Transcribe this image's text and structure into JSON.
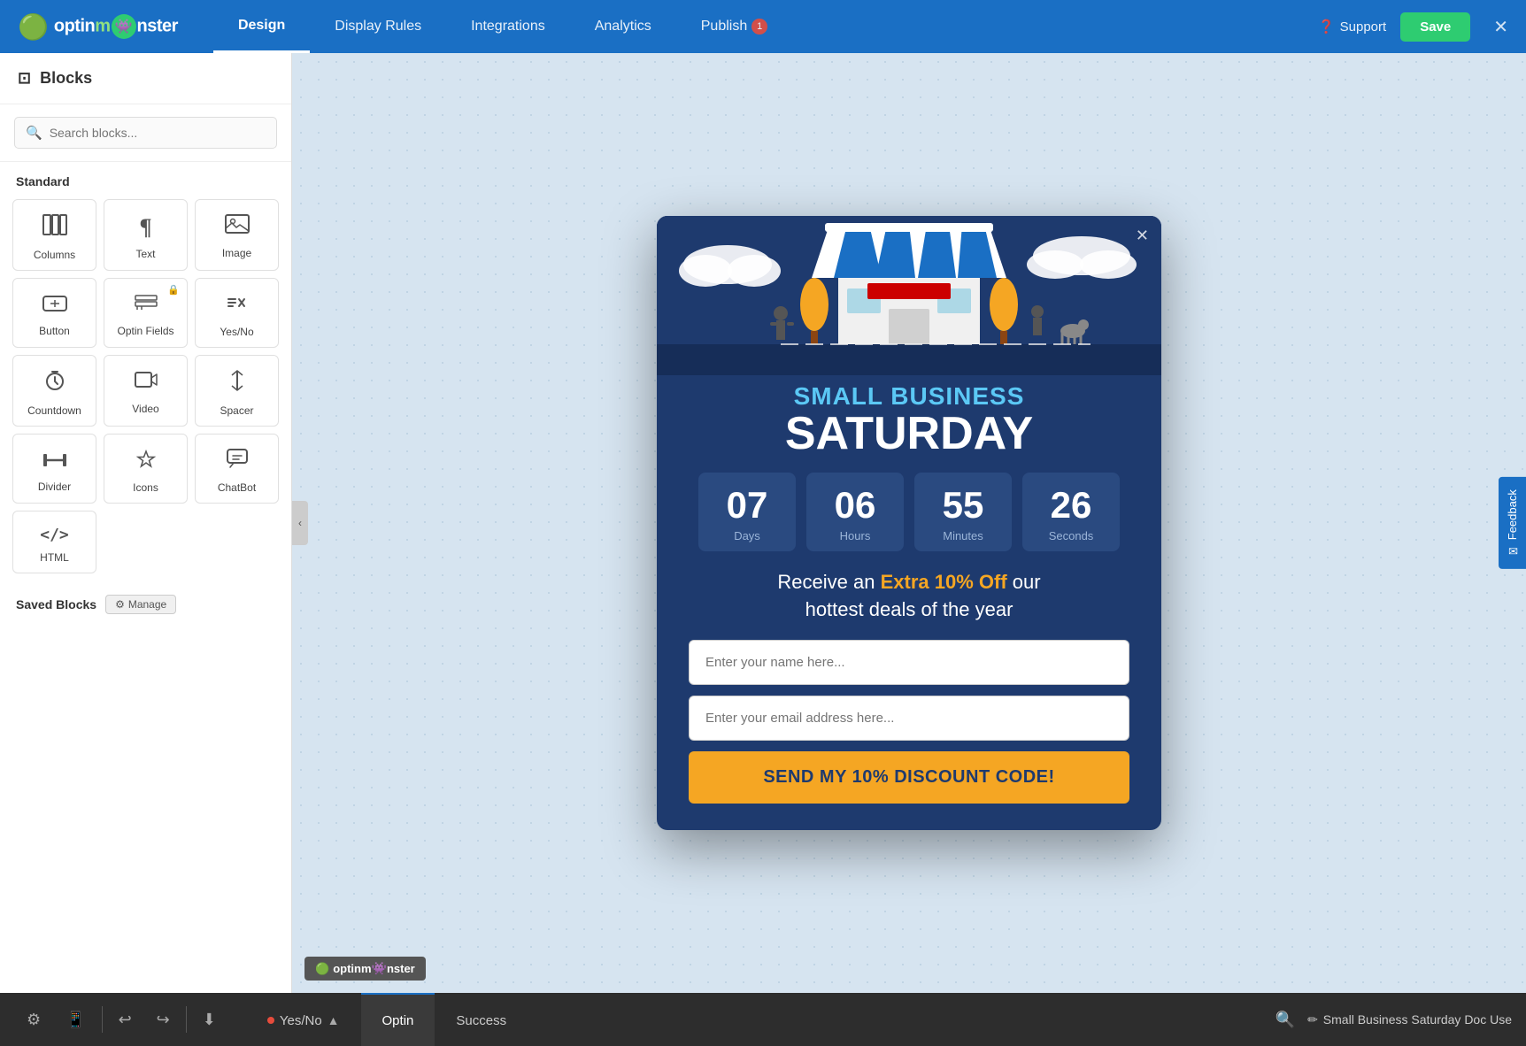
{
  "nav": {
    "logo_text": "optinm nster",
    "links": [
      {
        "label": "Design",
        "active": true
      },
      {
        "label": "Display Rules",
        "active": false
      },
      {
        "label": "Integrations",
        "active": false
      },
      {
        "label": "Analytics",
        "active": false
      },
      {
        "label": "Publish",
        "active": false,
        "badge": "1"
      }
    ],
    "support_label": "Support",
    "save_label": "Save"
  },
  "sidebar": {
    "title": "Blocks",
    "search_placeholder": "Search blocks...",
    "section_standard": "Standard",
    "blocks": [
      {
        "id": "columns",
        "label": "Columns",
        "icon": "⊞",
        "locked": false
      },
      {
        "id": "text",
        "label": "Text",
        "icon": "¶",
        "locked": false
      },
      {
        "id": "image",
        "label": "Image",
        "icon": "🖼",
        "locked": false
      },
      {
        "id": "button",
        "label": "Button",
        "icon": "⊡",
        "locked": false
      },
      {
        "id": "optin-fields",
        "label": "Optin Fields",
        "icon": "≡",
        "locked": true
      },
      {
        "id": "yes-no",
        "label": "Yes/No",
        "icon": "⇄",
        "locked": false
      },
      {
        "id": "countdown",
        "label": "Countdown",
        "icon": "⏰",
        "locked": false
      },
      {
        "id": "video",
        "label": "Video",
        "icon": "▶",
        "locked": false
      },
      {
        "id": "spacer",
        "label": "Spacer",
        "icon": "↕",
        "locked": false
      },
      {
        "id": "divider",
        "label": "Divider",
        "icon": "⊣",
        "locked": false
      },
      {
        "id": "icons",
        "label": "Icons",
        "icon": "❤",
        "locked": false
      },
      {
        "id": "chatbot",
        "label": "ChatBot",
        "icon": "💬",
        "locked": false
      },
      {
        "id": "html",
        "label": "HTML",
        "icon": "</>",
        "locked": false
      }
    ],
    "saved_blocks_label": "Saved Blocks",
    "manage_label": "Manage"
  },
  "popup": {
    "close_icon": "✕",
    "title_line1": "SMALL BUSINESS",
    "title_line2": "SATURDAY",
    "countdown": {
      "days": {
        "value": "07",
        "label": "Days"
      },
      "hours": {
        "value": "06",
        "label": "Hours"
      },
      "minutes": {
        "value": "55",
        "label": "Minutes"
      },
      "seconds": {
        "value": "26",
        "label": "Seconds"
      }
    },
    "offer_text_before": "Receive an ",
    "offer_highlight": "Extra 10% Off",
    "offer_text_after": " our\nhottest deals of the year",
    "name_placeholder": "Enter your name here...",
    "email_placeholder": "Enter your email address here...",
    "cta_label": "Send My 10% Discount Code!"
  },
  "watermark": {
    "label": "optinm nster"
  },
  "feedback": {
    "label": "Feedback"
  },
  "bottom_bar": {
    "tabs": [
      {
        "label": "Yes/No",
        "active": false,
        "has_dot": true
      },
      {
        "label": "Optin",
        "active": true,
        "has_dot": false
      },
      {
        "label": "Success",
        "active": false,
        "has_dot": false
      }
    ],
    "doc_name": "Small Business Saturday Doc Use",
    "pencil_icon": "✏"
  }
}
